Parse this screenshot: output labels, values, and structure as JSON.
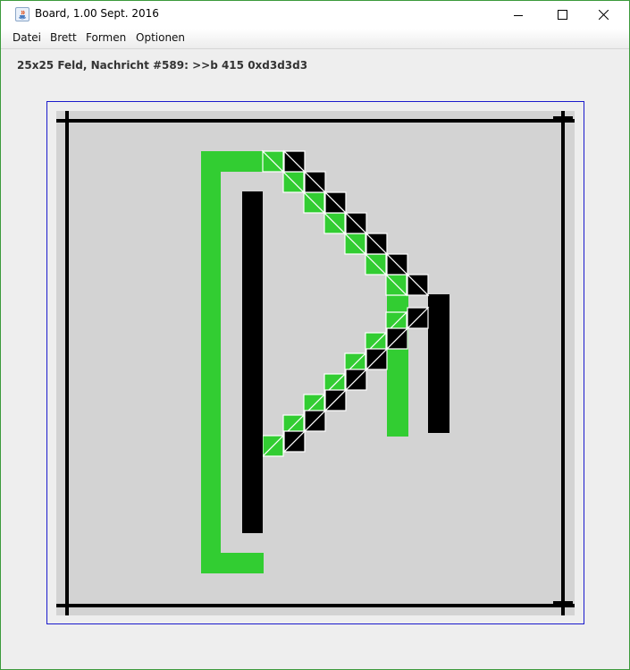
{
  "window": {
    "title": "Board, 1.00 Sept. 2016",
    "icon": "java-cup-icon",
    "controls": [
      "minimize-icon",
      "maximize-icon",
      "close-icon"
    ]
  },
  "menu": {
    "items": [
      "Datei",
      "Brett",
      "Formen",
      "Optionen"
    ]
  },
  "status": {
    "text": "25x25 Feld, Nachricht #589: >>b 415 0xd3d3d3"
  },
  "board": {
    "grid_size": 25,
    "background_color": "#d3d3d3",
    "green_color": "#32cd32",
    "black_color": "#000000",
    "shapes": [
      "outer-frame-lines",
      "green-d-outline",
      "green-d-diagonal-triangles",
      "black-d-outline",
      "black-d-diagonal-triangles",
      "black-inner-bar"
    ]
  }
}
